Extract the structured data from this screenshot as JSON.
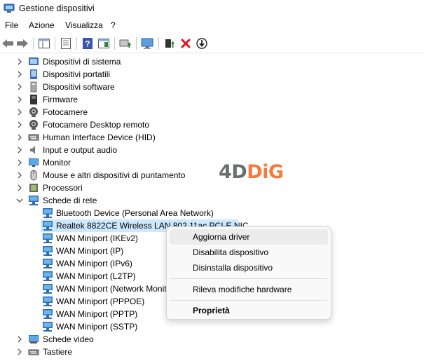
{
  "window": {
    "title": "Gestione dispositivi"
  },
  "menu": {
    "items": [
      "File",
      "Azione",
      "Visualizza",
      "?"
    ]
  },
  "toolbar": {
    "buttons": [
      "back-arrow-icon",
      "forward-arrow-icon",
      "show-hide-tree-icon",
      "properties-icon",
      "help-icon",
      "view-icon",
      "update-driver-icon",
      "monitor-scan-icon",
      "add-driver-icon",
      "uninstall-x-icon",
      "download-icon"
    ]
  },
  "tree": {
    "categories": [
      {
        "label": "Dispositivi di sistema",
        "icon": "system-devices-icon",
        "expanded": false
      },
      {
        "label": "Dispositivi portatili",
        "icon": "portable-devices-icon",
        "expanded": false
      },
      {
        "label": "Dispositivi software",
        "icon": "software-devices-icon",
        "expanded": false
      },
      {
        "label": "Firmware",
        "icon": "firmware-icon",
        "expanded": false
      },
      {
        "label": "Fotocamere",
        "icon": "camera-icon",
        "expanded": false
      },
      {
        "label": "Fotocamere Desktop remoto",
        "icon": "camera-icon",
        "expanded": false
      },
      {
        "label": "Human Interface Device (HID)",
        "icon": "hid-icon",
        "expanded": false
      },
      {
        "label": "Input e output audio",
        "icon": "audio-icon",
        "expanded": false
      },
      {
        "label": "Monitor",
        "icon": "monitor-icon",
        "expanded": false
      },
      {
        "label": "Mouse e altri dispositivi di puntamento",
        "icon": "mouse-icon",
        "expanded": false
      },
      {
        "label": "Processori",
        "icon": "processor-icon",
        "expanded": false
      },
      {
        "label": "Schede di rete",
        "icon": "network-adapter-icon",
        "expanded": true
      }
    ],
    "network_children": [
      "Bluetooth Device (Personal Area Network)",
      "Realtek 8822CE Wireless LAN 802.11ac PCI-E NIC",
      "WAN Miniport (IKEv2)",
      "WAN Miniport (IP)",
      "WAN Miniport (IPv6)",
      "WAN Miniport (L2TP)",
      "WAN Miniport (Network Monitor)",
      "WAN Miniport (PPPOE)",
      "WAN Miniport (PPTP)",
      "WAN Miniport (SSTP)"
    ],
    "after": [
      {
        "label": "Schede video",
        "icon": "display-adapter-icon"
      },
      {
        "label": "Tastiere",
        "icon": "keyboard-icon"
      }
    ]
  },
  "context_menu": {
    "items": [
      {
        "label": "Aggiorna driver",
        "bold": false
      },
      {
        "label": "Disabilita dispositivo",
        "bold": false
      },
      {
        "label": "Disinstalla dispositivo",
        "bold": false
      },
      {
        "label": "Rileva modifiche hardware",
        "bold": false
      },
      {
        "label": "Proprietà",
        "bold": true
      }
    ]
  },
  "watermark": {
    "part1": "4D",
    "part2": "DiG"
  },
  "colors": {
    "selection": "#cce8ff",
    "accent_orange": "#f47b3c",
    "uninstall_red": "#e81123"
  }
}
